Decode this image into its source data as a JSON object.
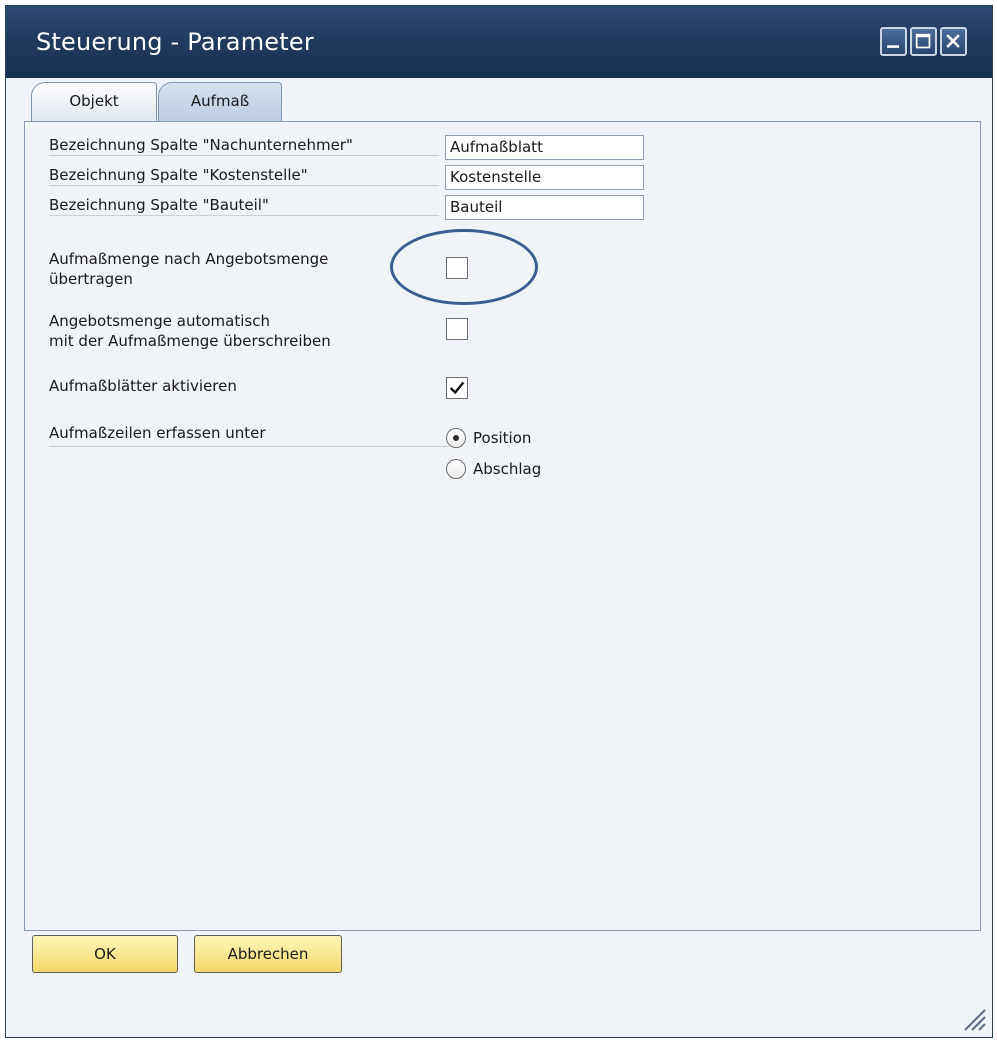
{
  "window": {
    "title": "Steuerung - Parameter"
  },
  "tabs": [
    {
      "label": "Objekt",
      "active": false
    },
    {
      "label": "Aufmaß",
      "active": true
    }
  ],
  "fields": [
    {
      "label": "Bezeichnung Spalte \"Nachunternehmer\"",
      "value": "Aufmaßblatt"
    },
    {
      "label": "Bezeichnung Spalte \"Kostenstelle\"",
      "value": "Kostenstelle"
    },
    {
      "label": "Bezeichnung Spalte \"Bauteil\"",
      "value": "Bauteil"
    }
  ],
  "checkboxes": [
    {
      "label_line1": "Aufmaßmenge nach Angebotsmenge",
      "label_line2": "übertragen",
      "checked": false
    },
    {
      "label_line1": "Angebotsmenge automatisch",
      "label_line2": "mit der Aufmaßmenge überschreiben",
      "checked": false
    },
    {
      "label": "Aufmaßblätter aktivieren",
      "checked": true
    }
  ],
  "radio_group": {
    "label": "Aufmaßzeilen erfassen unter",
    "options": [
      {
        "label": "Position",
        "selected": true
      },
      {
        "label": "Abschlag",
        "selected": false
      }
    ]
  },
  "buttons": {
    "ok": "OK",
    "cancel": "Abbrechen"
  },
  "colors": {
    "titlebar": "#1f3a5e",
    "button_fill": "#f5d86a",
    "highlight_circle": "#3b5d8f"
  }
}
